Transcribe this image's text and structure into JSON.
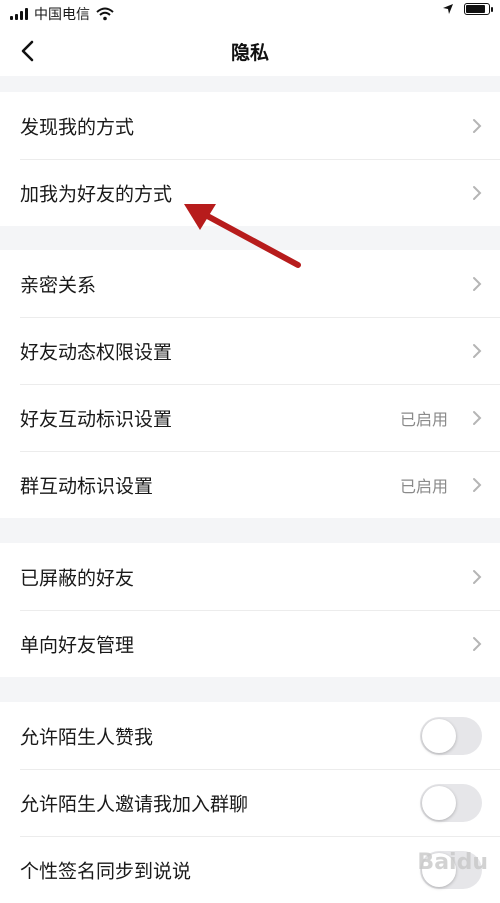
{
  "status_bar": {
    "carrier": "中国电信"
  },
  "nav": {
    "title": "隐私"
  },
  "groups": [
    {
      "items": [
        {
          "label": "发现我的方式",
          "value": ""
        },
        {
          "label": "加我为好友的方式",
          "value": ""
        }
      ]
    },
    {
      "items": [
        {
          "label": "亲密关系",
          "value": ""
        },
        {
          "label": "好友动态权限设置",
          "value": ""
        },
        {
          "label": "好友互动标识设置",
          "value": "已启用"
        },
        {
          "label": "群互动标识设置",
          "value": "已启用"
        }
      ]
    },
    {
      "items": [
        {
          "label": "已屏蔽的好友",
          "value": ""
        },
        {
          "label": "单向好友管理",
          "value": ""
        }
      ]
    },
    {
      "toggles": [
        {
          "label": "允许陌生人赞我",
          "on": false
        },
        {
          "label": "允许陌生人邀请我加入群聊",
          "on": false
        },
        {
          "label": "个性签名同步到说说",
          "on": false
        }
      ]
    }
  ],
  "annotation": {
    "arrow_color": "#b71c1c"
  },
  "watermark": "Baidu"
}
